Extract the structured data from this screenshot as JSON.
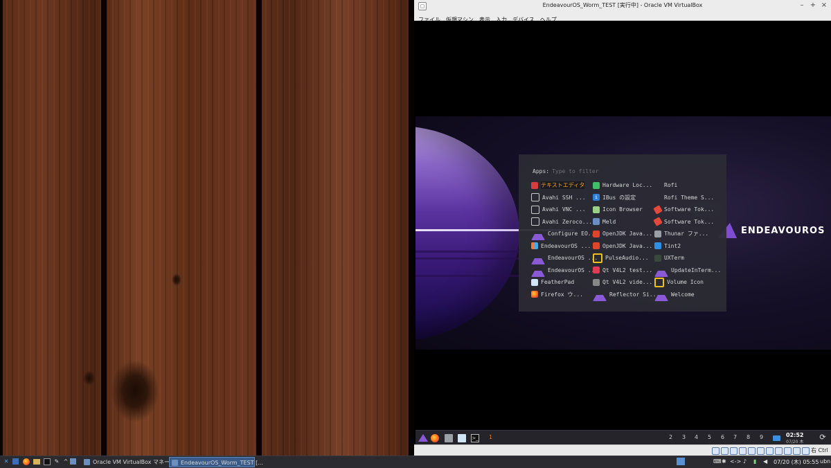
{
  "vbox_window": {
    "title": "EndeavourOS_Worm_TEST [実行中] - Oracle VM VirtualBox",
    "menu": [
      "ファイル",
      "仮想マシン",
      "表示",
      "入力",
      "デバイス",
      "ヘルプ"
    ],
    "status_key": "右 Ctrl"
  },
  "wallpaper": {
    "brand_text": "ENDEAVOUROS"
  },
  "rofi": {
    "prompt_label": "Apps:",
    "placeholder": "Type to filter",
    "columns": [
      [
        {
          "label": "テキストエディタ",
          "icon": "text-editor-icon",
          "selected": true
        },
        {
          "label": "Avahi SSH ...",
          "icon": "monitor-icon"
        },
        {
          "label": "Avahi VNC ...",
          "icon": "monitor-icon"
        },
        {
          "label": "Avahi Zeroco...",
          "icon": "monitor-icon"
        },
        {
          "label": "Configure EO...",
          "icon": "endeavouros-icon"
        },
        {
          "label": "EndeavourOS ...",
          "icon": "endeavouros-logo-icon"
        },
        {
          "label": "EndeavourOS ...",
          "icon": "endeavouros-icon"
        },
        {
          "label": "EndeavourOS ...",
          "icon": "endeavouros-icon"
        },
        {
          "label": "FeatherPad",
          "icon": "featherpad-icon"
        },
        {
          "label": "Firefox ウ...",
          "icon": "firefox-icon"
        }
      ],
      [
        {
          "label": "Hardware Loc...",
          "icon": "hardware-locale-icon"
        },
        {
          "label": "IBus の設定",
          "icon": "ibus-icon"
        },
        {
          "label": "Icon Browser",
          "icon": "icon-browser-icon"
        },
        {
          "label": "Meld",
          "icon": "meld-icon"
        },
        {
          "label": "OpenJDK Java...",
          "icon": "java-icon"
        },
        {
          "label": "OpenJDK Java...",
          "icon": "java-icon"
        },
        {
          "label": "PulseAudio...",
          "icon": "pulseaudio-icon"
        },
        {
          "label": "Qt V4L2 test...",
          "icon": "qt-v4l2-icon"
        },
        {
          "label": "Qt V4L2 vide...",
          "icon": "qt-video-icon"
        },
        {
          "label": "Reflector Si...",
          "icon": "endeavouros-icon"
        }
      ],
      [
        {
          "label": "Rofi",
          "icon": "none"
        },
        {
          "label": "Rofi Theme S...",
          "icon": "none"
        },
        {
          "label": "Software Tok...",
          "icon": "software-token-icon"
        },
        {
          "label": "Software Tok...",
          "icon": "software-token-icon"
        },
        {
          "label": "Thunar ファ...",
          "icon": "thunar-icon"
        },
        {
          "label": "Tint2",
          "icon": "tint2-icon"
        },
        {
          "label": "UXTerm",
          "icon": "terminal-icon"
        },
        {
          "label": "UpdateInTerm...",
          "icon": "endeavouros-icon"
        },
        {
          "label": "Volume Icon",
          "icon": "volume-icon"
        },
        {
          "label": "Welcome",
          "icon": "endeavouros-icon"
        }
      ]
    ]
  },
  "vm_panel": {
    "workspaces": [
      "1",
      "2",
      "3",
      "4",
      "5",
      "6",
      "7",
      "8",
      "9"
    ],
    "current_workspace": "1",
    "clock_time": "02:52",
    "clock_date": "07/20 木"
  },
  "host_taskbar": {
    "tasks": [
      {
        "label": "Oracle VM VirtualBox マネー...",
        "active": false
      },
      {
        "label": "EndeavourOS_Worm_TEST [...",
        "active": true
      }
    ],
    "clock": "07/20 (木) 05:55",
    "user": "ubn"
  }
}
